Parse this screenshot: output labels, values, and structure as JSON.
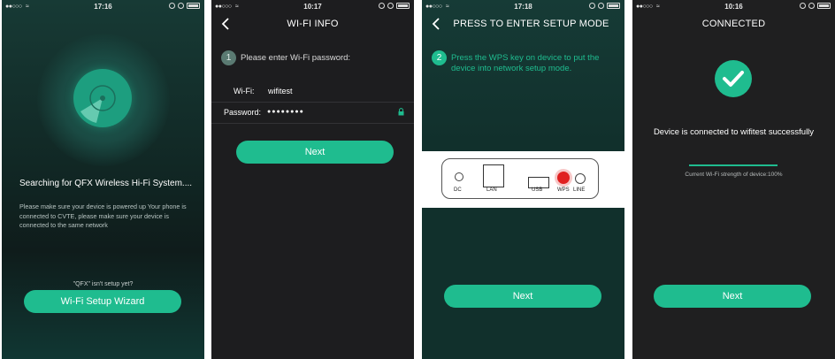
{
  "screens": [
    {
      "status": {
        "time": "17:16",
        "signal": "●●○○○"
      },
      "title": "Searching for QFX Wireless Hi-Fi System....",
      "body": "Please make sure your device is powered up Your phone is connected to CVTE, please make sure your device is connected to the same network",
      "hint": "\"QFX\" isn't setup yet?",
      "button": "Wi-Fi Setup Wizard"
    },
    {
      "status": {
        "time": "10:17",
        "signal": "●●○○○"
      },
      "nav_title": "WI-FI INFO",
      "step_number": "1",
      "step_text": "Please enter Wi-Fi password:",
      "wifi_label": "Wi-Fi:",
      "wifi_value": "wifitest",
      "password_label": "Password:",
      "password_value": "●●●●●●●●",
      "button": "Next"
    },
    {
      "status": {
        "time": "17:18",
        "signal": "●●○○○"
      },
      "nav_title": "PRESS TO ENTER SETUP MODE",
      "step_number": "2",
      "step_text": "Press the WPS key on device to put the device into network setup mode.",
      "ports": [
        "DC",
        "LAN",
        "USB",
        "WPS",
        "LINE"
      ],
      "button": "Next"
    },
    {
      "status": {
        "time": "10:16",
        "signal": "●●○○○"
      },
      "nav_title": "CONNECTED",
      "message": "Device is connected to wifitest successfully",
      "strength_text": "Current Wi-Fi strength of device:100%",
      "strength_fraction": 1.0,
      "button": "Next"
    }
  ],
  "colors": {
    "accent": "#1fbc8f",
    "wps_red": "#e02020"
  },
  "icons": [
    "back-chevron-icon",
    "radar-icon",
    "lock-icon",
    "checkmark-icon",
    "wifi-icon",
    "battery-icon"
  ]
}
